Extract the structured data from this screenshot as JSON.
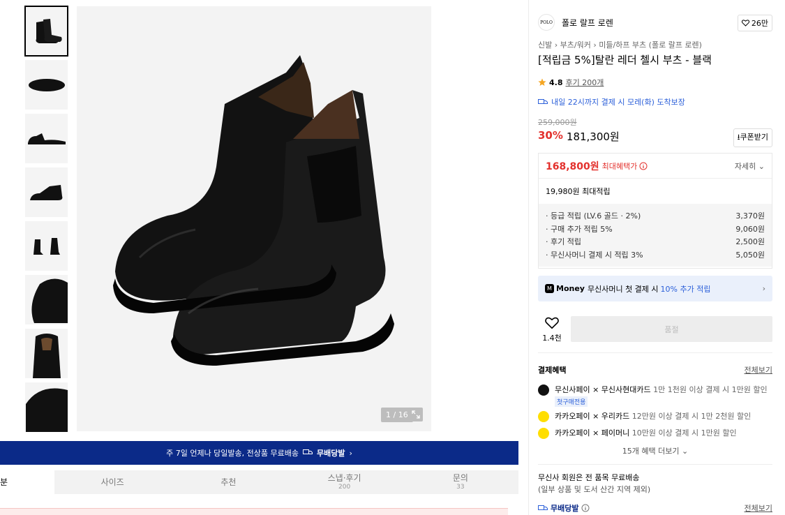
{
  "gallery": {
    "counter": "1 / 16",
    "thumbnails": [
      "chelsea-boots-pair",
      "boot-sole",
      "boot-side",
      "boot-angle",
      "boots-front-back",
      "boot-toe-closeup",
      "boot-inner-lining",
      "boot-detail"
    ]
  },
  "banner": {
    "text": "주 7일 언제나 당일발송, 전상품 무료배송",
    "badge": "무배당발",
    "chevron": "›"
  },
  "tabs": [
    {
      "label": "분",
      "count": ""
    },
    {
      "label": "사이즈",
      "count": ""
    },
    {
      "label": "추천",
      "count": ""
    },
    {
      "label": "스냅·후기",
      "count": "200"
    },
    {
      "label": "문의",
      "count": "33"
    }
  ],
  "brand": {
    "logo_text": "POLO",
    "name": "폴로 랄프 로렌",
    "likes": "26만"
  },
  "breadcrumb": [
    "신발",
    "부츠/워커",
    "미들/하프 부츠 (폴로 랄프 로렌)"
  ],
  "product": {
    "title": "[적립금 5%]탈란 레더 첼시 부츠 - 블랙",
    "rating": "4.8",
    "reviews": "후기 200개",
    "delivery": "내일 22시까지 결제 시 모레(화) 도착보장",
    "original_price": "259,000원",
    "discount": "30%",
    "price": "181,300원",
    "coupon": "쿠폰받기"
  },
  "benefit": {
    "amount": "168,800원",
    "label": "최대혜택가",
    "detail": "자세히",
    "points_total": "19,980원 최대적립",
    "rows": [
      {
        "label": "· 등급 적립 (LV.6 골드 · 2%)",
        "value": "3,370원"
      },
      {
        "label": "· 구매 추가 적립 5%",
        "value": "9,060원"
      },
      {
        "label": "· 후기 적립",
        "value": "2,500원"
      },
      {
        "label": "· 무신사머니 결제 시 적립 3%",
        "value": "5,050원"
      }
    ]
  },
  "money": {
    "brand": "Money",
    "text": "무신사머니 첫 결제 시",
    "highlight": "10% 추가 적립"
  },
  "actions": {
    "wish_count": "1.4천",
    "soldout": "품절"
  },
  "payment": {
    "title": "결제혜택",
    "view_all": "전체보기",
    "items": [
      {
        "name": "무신사페이 × 무신사현대카드",
        "desc": "1만 1천원 이상 결제 시 1만원 할인",
        "badge": "첫구매전용",
        "color": "#111111"
      },
      {
        "name": "카카오페이 × 우리카드",
        "desc": "12만원 이상 결제 시 1만 2천원 할인",
        "badge": "",
        "color": "#ffde00"
      },
      {
        "name": "카카오페이 × 페이머니",
        "desc": "10만원 이상 결제 시 1만원 할인",
        "badge": "",
        "color": "#ffde00"
      }
    ],
    "more": "15개 혜택 더보기"
  },
  "shipping": {
    "line1": "무신사 회원은 전 품목 무료배송",
    "line2": "(일부 상품 및 도서 산간 지역 제외)",
    "badge": "무배당발",
    "view_all": "전체보기"
  }
}
